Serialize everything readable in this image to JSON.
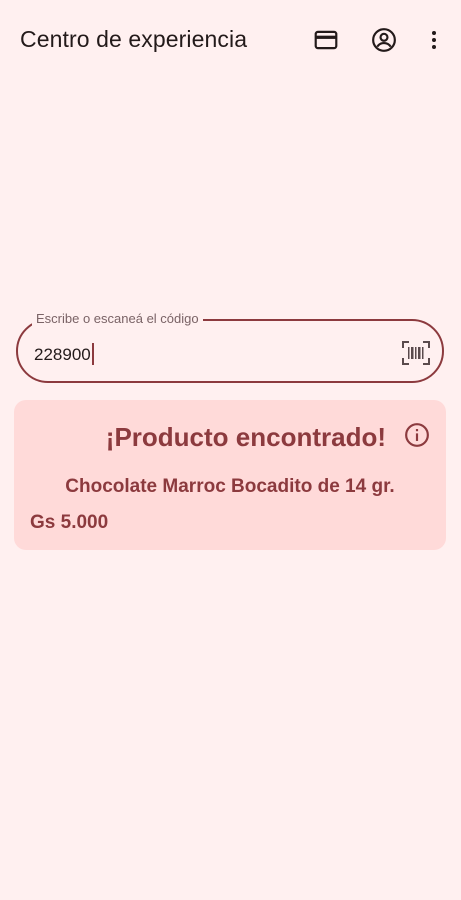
{
  "appbar": {
    "title": "Centro de experiencia",
    "icons": [
      "credit-card-icon",
      "account-circle-icon",
      "more-vert-icon"
    ]
  },
  "search": {
    "label": "Escribe o escaneá el código",
    "value": "228900",
    "scan_icon": "barcode-scan-icon"
  },
  "result": {
    "title": "¡Producto encontrado!",
    "info_icon": "info-icon",
    "product_name": "Chocolate Marroc Bocadito de 14 gr.",
    "price": "Gs 5.000"
  },
  "colors": {
    "background": "#fff0f0",
    "accent": "#8c3a3e",
    "card": "#ffdad9"
  }
}
